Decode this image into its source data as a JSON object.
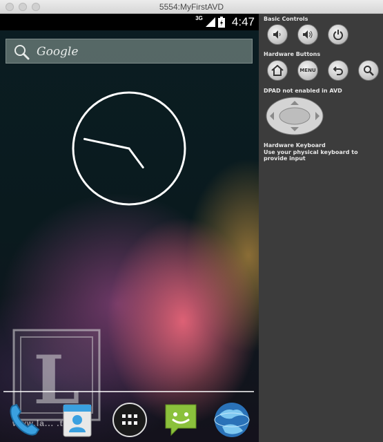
{
  "window": {
    "title": "5554:MyFirstAVD"
  },
  "status_bar": {
    "network": "3G",
    "time": "4:47"
  },
  "home": {
    "search_label": "Google",
    "clock": {
      "hour": 4,
      "minute": 47
    },
    "watermark_letter": "L",
    "watermark_url": "www.la... .tw"
  },
  "dock": {
    "apps_button": "apps-grid",
    "items": [
      "phone",
      "contacts",
      "apps",
      "messaging",
      "browser"
    ]
  },
  "controls": {
    "basic_title": "Basic Controls",
    "hardware_title": "Hardware Buttons",
    "menu_label": "MENU",
    "dpad_note": "DPAD not enabled in AVD",
    "keyboard_title": "Hardware Keyboard",
    "keyboard_note": "Use your physical keyboard to provide input"
  }
}
